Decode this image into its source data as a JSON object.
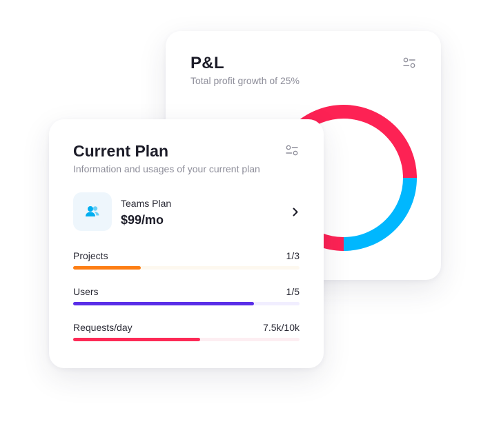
{
  "pl": {
    "title": "P&L",
    "subtitle": "Total profit growth of 25%",
    "filter_icon": "sliders-icon",
    "donut": {
      "segments": [
        {
          "color": "#fd2254",
          "share": 0.75
        },
        {
          "color": "#00b7fe",
          "share": 0.25
        }
      ]
    }
  },
  "plan": {
    "title": "Current Plan",
    "subtitle": "Information and usages of your current plan",
    "filter_icon": "sliders-icon",
    "plan_icon": "users-icon",
    "plan_name": "Teams Plan",
    "plan_price": "$99/mo",
    "chevron_icon": "chevron-right-icon",
    "usage": [
      {
        "label": "Projects",
        "value": "1/3",
        "level": 0.3,
        "color": "#fd7e14",
        "track": "#fdf8ef"
      },
      {
        "label": "Users",
        "value": "1/5",
        "level": 0.8,
        "color": "#5a2ee8",
        "track": "#f1eeff"
      },
      {
        "label": "Requests/day",
        "value": "7.5k/10k",
        "level": 0.56,
        "color": "#fd2a56",
        "track": "#fdeef2"
      }
    ]
  }
}
